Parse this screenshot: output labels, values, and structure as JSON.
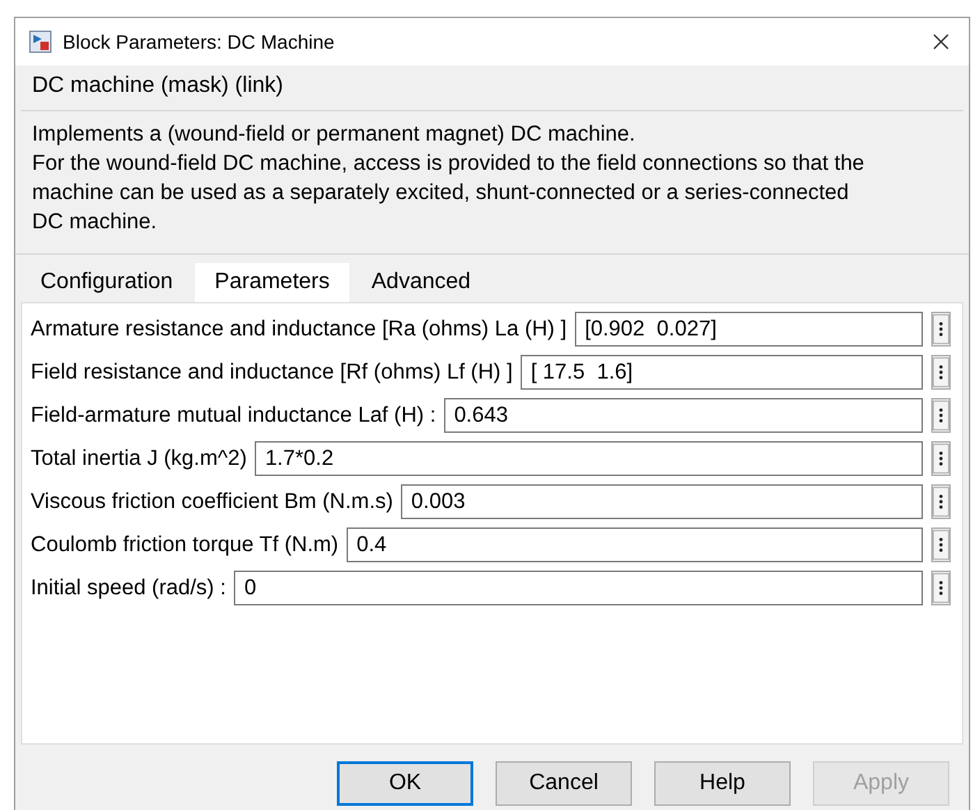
{
  "window": {
    "title": "Block Parameters: DC Machine"
  },
  "mask_title": "DC machine (mask) (link)",
  "description": "Implements a (wound-field or permanent magnet) DC machine.\nFor the wound-field DC machine, access is provided to the field connections so that the machine can be used as a separately excited, shunt-connected or a series-connected  DC machine.",
  "tabs": [
    {
      "label": "Configuration",
      "selected": false
    },
    {
      "label": "Parameters",
      "selected": true
    },
    {
      "label": "Advanced",
      "selected": false
    }
  ],
  "parameters": [
    {
      "label": "Armature resistance and inductance [Ra (ohms) La (H) ]",
      "value": "[0.902  0.027]"
    },
    {
      "label": "Field resistance and inductance [Rf (ohms) Lf (H) ]",
      "value": "[ 17.5  1.6]"
    },
    {
      "label": "Field-armature mutual inductance Laf (H) :",
      "value": "0.643"
    },
    {
      "label": "Total inertia J (kg.m^2)",
      "value": "1.7*0.2"
    },
    {
      "label": "Viscous friction coefficient Bm (N.m.s)",
      "value": "0.003"
    },
    {
      "label": "Coulomb friction torque Tf (N.m)",
      "value": "0.4"
    },
    {
      "label": "Initial speed (rad/s) :",
      "value": "0"
    }
  ],
  "buttons": [
    {
      "label": "OK",
      "disabled": false,
      "default": true
    },
    {
      "label": "Cancel",
      "disabled": false,
      "default": false
    },
    {
      "label": "Help",
      "disabled": false,
      "default": false
    },
    {
      "label": "Apply",
      "disabled": true,
      "default": false
    }
  ]
}
